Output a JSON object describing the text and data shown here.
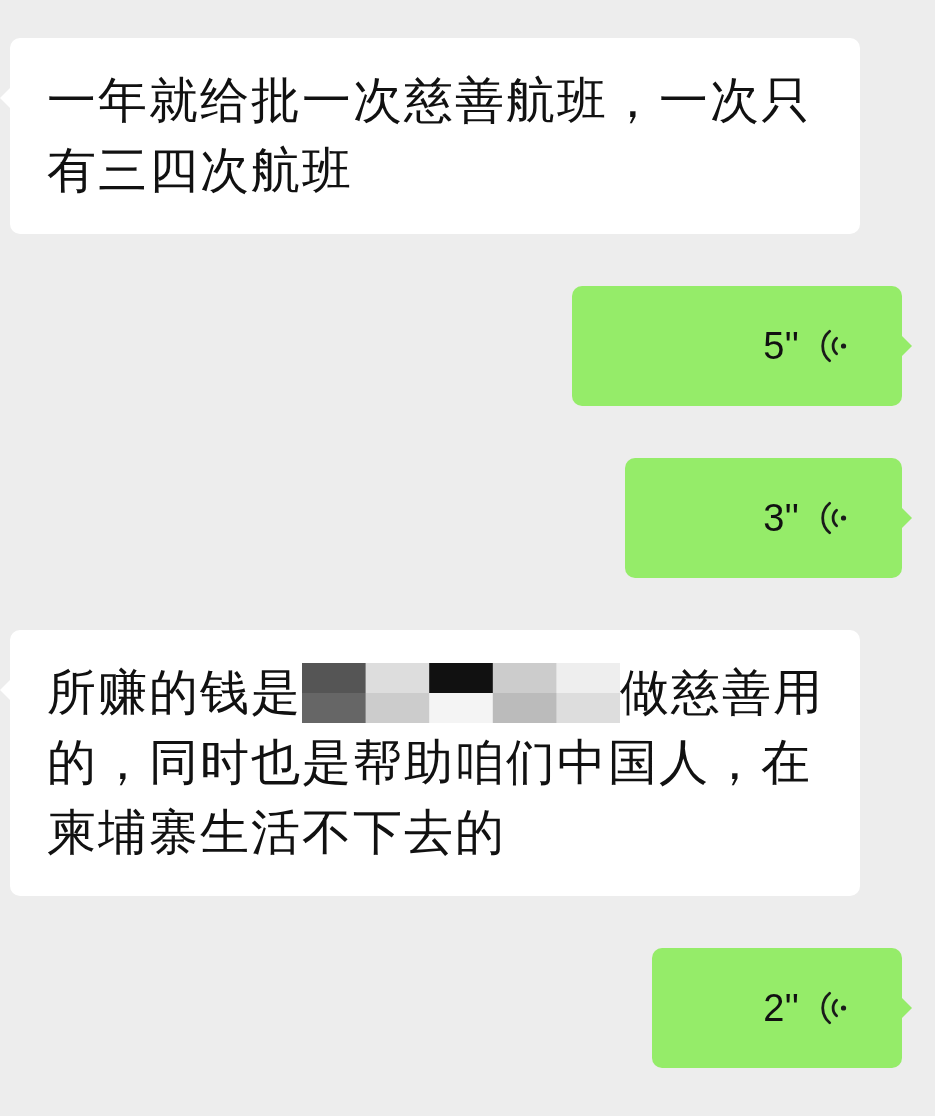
{
  "messages": [
    {
      "kind": "text",
      "parts": [
        {
          "kind": "block",
          "text": "一年就给批一次慈善航班，一次只有三四次航班"
        }
      ]
    },
    {
      "kind": "voice",
      "duration": "5''"
    },
    {
      "kind": "voice",
      "duration": "3''"
    },
    {
      "kind": "text",
      "parts": [
        {
          "kind": "text",
          "text": "所赚的钱是"
        },
        {
          "kind": "censored"
        },
        {
          "kind": "text",
          "text": "做慈善用"
        },
        {
          "kind": "block",
          "text": "的，同时也是帮助咱们中国人，在柬埔寨生活不下去的"
        }
      ]
    },
    {
      "kind": "voice",
      "duration": "2''"
    }
  ]
}
